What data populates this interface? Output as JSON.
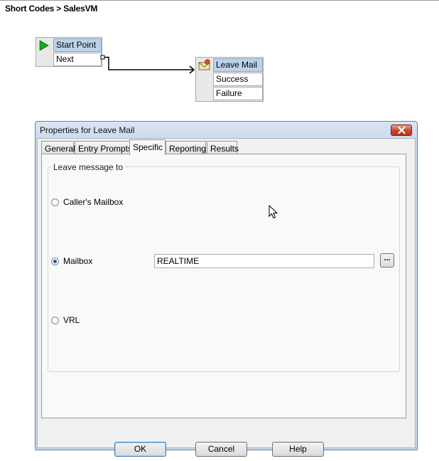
{
  "breadcrumb": "Short Codes > SalesVM",
  "flow": {
    "start_node": {
      "title": "Start Point",
      "ports": [
        "Next"
      ]
    },
    "action_node": {
      "title": "Leave Mail",
      "ports": [
        "Success",
        "Failure"
      ]
    }
  },
  "dialog": {
    "title": "Properties for Leave Mail",
    "tabs": [
      {
        "label": "General"
      },
      {
        "label": "Entry Prompts"
      },
      {
        "label": "Specific",
        "active": true
      },
      {
        "label": "Reporting"
      },
      {
        "label": "Results"
      }
    ],
    "group_label": "Leave message to",
    "options": [
      {
        "label": "Caller's Mailbox",
        "checked": false
      },
      {
        "label": "Mailbox",
        "checked": true
      },
      {
        "label": "VRL",
        "checked": false
      }
    ],
    "mailbox_value": "REALTIME",
    "browse_label": "...",
    "buttons": {
      "ok": "OK",
      "cancel": "Cancel",
      "help": "Help"
    }
  },
  "colors": {
    "node_title_bg": "#bcd2ea",
    "dialog_frame": "#c9d8ec",
    "close_button": "#c7432b",
    "radio_checked": "#1f56b6",
    "start_arrow": "#1aa51a"
  }
}
